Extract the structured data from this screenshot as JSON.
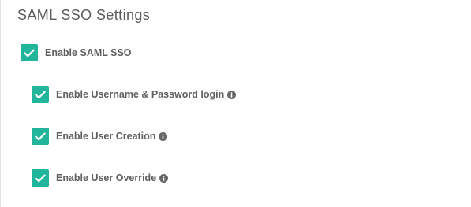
{
  "section": {
    "title": "SAML SSO Settings"
  },
  "colors": {
    "checkbox_accent": "#21b59b",
    "text": "#5f5f5f",
    "title": "#5b5b5b"
  },
  "options": [
    {
      "label": "Enable SAML SSO",
      "checked": true,
      "info_icon": false
    },
    {
      "label": "Enable Username & Password login",
      "checked": true,
      "info_icon": true
    },
    {
      "label": "Enable User Creation",
      "checked": true,
      "info_icon": true
    },
    {
      "label": "Enable User Override",
      "checked": true,
      "info_icon": true
    }
  ]
}
